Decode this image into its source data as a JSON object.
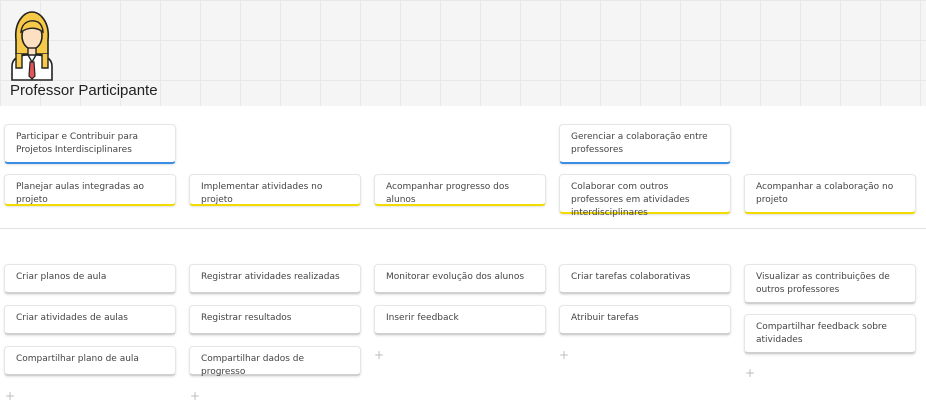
{
  "persona": {
    "title": "Professor Participante"
  },
  "goals": [
    "Participar e Contribuir para Projetos Interdisciplinares",
    "Gerenciar a colaboração entre professores"
  ],
  "activities": [
    "Planejar aulas integradas ao projeto",
    "Implementar atividades no projeto",
    "Acompanhar progresso dos alunos",
    "Colaborar com outros professores em atividades interdisciplinares",
    "Acompanhar a colaboração no projeto"
  ],
  "tasks": {
    "col1": [
      "Criar planos de aula",
      "Criar atividades de aulas",
      "Compartilhar plano de aula"
    ],
    "col2": [
      "Registrar atividades realizadas",
      "Registrar resultados",
      "Compartilhar dados de progresso"
    ],
    "col3": [
      "Monitorar evolução dos alunos",
      "Inserir feedback"
    ],
    "col4": [
      "Criar tarefas colaborativas",
      "Atribuir tarefas"
    ],
    "col5": [
      "Visualizar as contribuições de outros professores",
      "Compartilhar feedback sobre atividades"
    ]
  },
  "add_symbol": "+",
  "colors": {
    "goal_accent": "#3a8ee6",
    "activity_accent": "#f2dc00",
    "task_accent": "#d0d0d0"
  }
}
